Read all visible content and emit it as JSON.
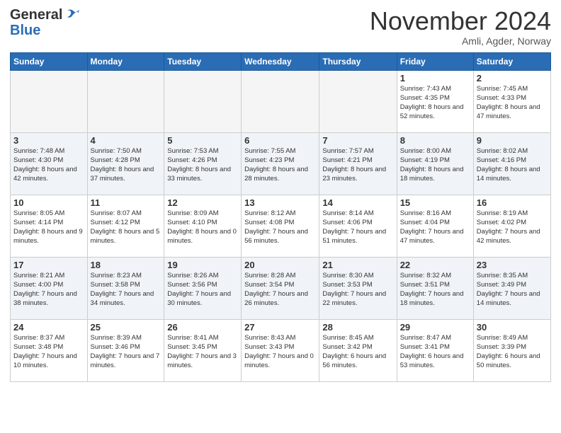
{
  "header": {
    "logo": {
      "general": "General",
      "blue": "Blue"
    },
    "title": "November 2024",
    "location": "Amli, Agder, Norway"
  },
  "calendar": {
    "days_of_week": [
      "Sunday",
      "Monday",
      "Tuesday",
      "Wednesday",
      "Thursday",
      "Friday",
      "Saturday"
    ],
    "weeks": [
      [
        {
          "day": "",
          "info": ""
        },
        {
          "day": "",
          "info": ""
        },
        {
          "day": "",
          "info": ""
        },
        {
          "day": "",
          "info": ""
        },
        {
          "day": "",
          "info": ""
        },
        {
          "day": "1",
          "info": "Sunrise: 7:43 AM\nSunset: 4:35 PM\nDaylight: 8 hours and 52 minutes."
        },
        {
          "day": "2",
          "info": "Sunrise: 7:45 AM\nSunset: 4:33 PM\nDaylight: 8 hours and 47 minutes."
        }
      ],
      [
        {
          "day": "3",
          "info": "Sunrise: 7:48 AM\nSunset: 4:30 PM\nDaylight: 8 hours and 42 minutes."
        },
        {
          "day": "4",
          "info": "Sunrise: 7:50 AM\nSunset: 4:28 PM\nDaylight: 8 hours and 37 minutes."
        },
        {
          "day": "5",
          "info": "Sunrise: 7:53 AM\nSunset: 4:26 PM\nDaylight: 8 hours and 33 minutes."
        },
        {
          "day": "6",
          "info": "Sunrise: 7:55 AM\nSunset: 4:23 PM\nDaylight: 8 hours and 28 minutes."
        },
        {
          "day": "7",
          "info": "Sunrise: 7:57 AM\nSunset: 4:21 PM\nDaylight: 8 hours and 23 minutes."
        },
        {
          "day": "8",
          "info": "Sunrise: 8:00 AM\nSunset: 4:19 PM\nDaylight: 8 hours and 18 minutes."
        },
        {
          "day": "9",
          "info": "Sunrise: 8:02 AM\nSunset: 4:16 PM\nDaylight: 8 hours and 14 minutes."
        }
      ],
      [
        {
          "day": "10",
          "info": "Sunrise: 8:05 AM\nSunset: 4:14 PM\nDaylight: 8 hours and 9 minutes."
        },
        {
          "day": "11",
          "info": "Sunrise: 8:07 AM\nSunset: 4:12 PM\nDaylight: 8 hours and 5 minutes."
        },
        {
          "day": "12",
          "info": "Sunrise: 8:09 AM\nSunset: 4:10 PM\nDaylight: 8 hours and 0 minutes."
        },
        {
          "day": "13",
          "info": "Sunrise: 8:12 AM\nSunset: 4:08 PM\nDaylight: 7 hours and 56 minutes."
        },
        {
          "day": "14",
          "info": "Sunrise: 8:14 AM\nSunset: 4:06 PM\nDaylight: 7 hours and 51 minutes."
        },
        {
          "day": "15",
          "info": "Sunrise: 8:16 AM\nSunset: 4:04 PM\nDaylight: 7 hours and 47 minutes."
        },
        {
          "day": "16",
          "info": "Sunrise: 8:19 AM\nSunset: 4:02 PM\nDaylight: 7 hours and 42 minutes."
        }
      ],
      [
        {
          "day": "17",
          "info": "Sunrise: 8:21 AM\nSunset: 4:00 PM\nDaylight: 7 hours and 38 minutes."
        },
        {
          "day": "18",
          "info": "Sunrise: 8:23 AM\nSunset: 3:58 PM\nDaylight: 7 hours and 34 minutes."
        },
        {
          "day": "19",
          "info": "Sunrise: 8:26 AM\nSunset: 3:56 PM\nDaylight: 7 hours and 30 minutes."
        },
        {
          "day": "20",
          "info": "Sunrise: 8:28 AM\nSunset: 3:54 PM\nDaylight: 7 hours and 26 minutes."
        },
        {
          "day": "21",
          "info": "Sunrise: 8:30 AM\nSunset: 3:53 PM\nDaylight: 7 hours and 22 minutes."
        },
        {
          "day": "22",
          "info": "Sunrise: 8:32 AM\nSunset: 3:51 PM\nDaylight: 7 hours and 18 minutes."
        },
        {
          "day": "23",
          "info": "Sunrise: 8:35 AM\nSunset: 3:49 PM\nDaylight: 7 hours and 14 minutes."
        }
      ],
      [
        {
          "day": "24",
          "info": "Sunrise: 8:37 AM\nSunset: 3:48 PM\nDaylight: 7 hours and 10 minutes."
        },
        {
          "day": "25",
          "info": "Sunrise: 8:39 AM\nSunset: 3:46 PM\nDaylight: 7 hours and 7 minutes."
        },
        {
          "day": "26",
          "info": "Sunrise: 8:41 AM\nSunset: 3:45 PM\nDaylight: 7 hours and 3 minutes."
        },
        {
          "day": "27",
          "info": "Sunrise: 8:43 AM\nSunset: 3:43 PM\nDaylight: 7 hours and 0 minutes."
        },
        {
          "day": "28",
          "info": "Sunrise: 8:45 AM\nSunset: 3:42 PM\nDaylight: 6 hours and 56 minutes."
        },
        {
          "day": "29",
          "info": "Sunrise: 8:47 AM\nSunset: 3:41 PM\nDaylight: 6 hours and 53 minutes."
        },
        {
          "day": "30",
          "info": "Sunrise: 8:49 AM\nSunset: 3:39 PM\nDaylight: 6 hours and 50 minutes."
        }
      ]
    ]
  }
}
